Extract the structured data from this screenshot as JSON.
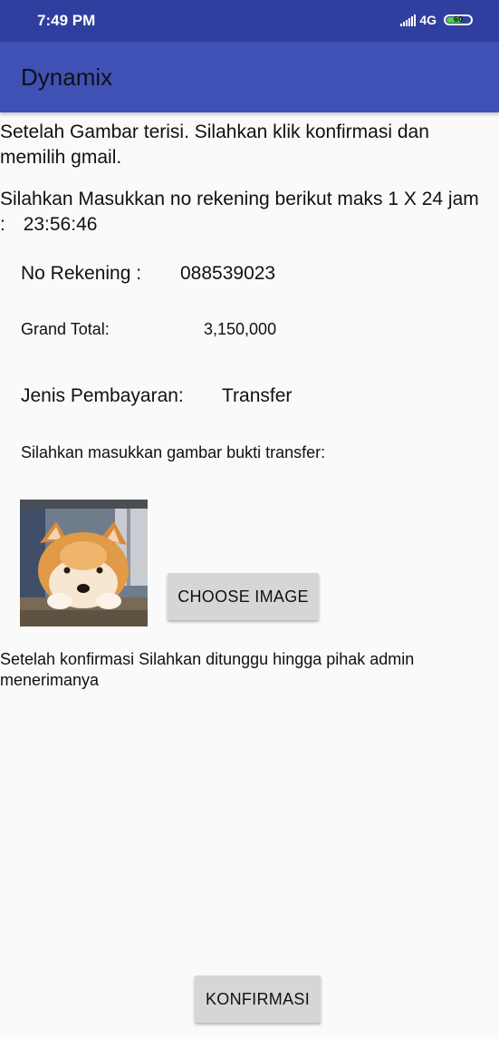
{
  "status_bar": {
    "time": "7:49 PM",
    "network": "4G",
    "battery": "60"
  },
  "app_bar": {
    "title": "Dynamix"
  },
  "content": {
    "instruction_1": "Setelah Gambar terisi. Silahkan klik konfirmasi dan memilih gmail.",
    "instruction_2": "Silahkan Masukkan no rekening berikut maks 1 X 24 jam :",
    "countdown": "23:56:46",
    "account_label": "No Rekening :",
    "account_value": "088539023",
    "total_label": "Grand Total:",
    "total_value": "3,150,000",
    "payment_label": "Jenis Pembayaran:",
    "payment_value": "Transfer",
    "upload_prompt": "Silahkan masukkan gambar bukti transfer:",
    "choose_image_label": "CHOOSE IMAGE",
    "after_confirm_note": "Setelah konfirmasi Silahkan ditunggu hingga pihak admin menerimanya",
    "confirm_label": "KONFIRMASI"
  }
}
